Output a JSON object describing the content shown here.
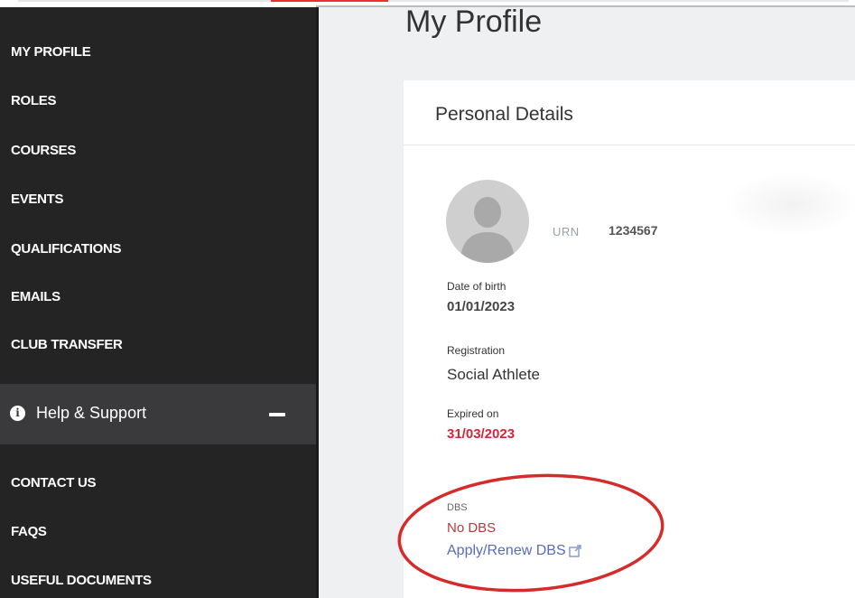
{
  "sidebar": {
    "items": [
      {
        "label": "MY PROFILE"
      },
      {
        "label": "ROLES"
      },
      {
        "label": "COURSES"
      },
      {
        "label": "EVENTS"
      },
      {
        "label": "QUALIFICATIONS"
      },
      {
        "label": "EMAILS"
      },
      {
        "label": "CLUB TRANSFER"
      }
    ],
    "help": {
      "label": "Help & Support",
      "icon": "info-icon",
      "toggle_icon": "minus-icon"
    },
    "support_items": [
      {
        "label": "CONTACT US"
      },
      {
        "label": "FAQS"
      },
      {
        "label": "USEFUL DOCUMENTS"
      }
    ]
  },
  "main": {
    "title": "My Profile",
    "card": {
      "title": "Personal Details",
      "urn_label": "URN",
      "urn_value": "1234567",
      "dob_label": "Date of birth",
      "dob_value": "01/01/2023",
      "registration_label": "Registration",
      "registration_value": "Social Athlete",
      "expired_label": "Expired on",
      "expired_value": "31/03/2023",
      "dbs_label": "DBS",
      "dbs_status": "No DBS",
      "dbs_link": "Apply/Renew DBS"
    }
  },
  "colors": {
    "sidebar_bg": "#242424",
    "help_bg": "#3a3a3c",
    "expired": "#d4253a",
    "link": "#5a6bb5",
    "annotation": "#d42b2b"
  }
}
